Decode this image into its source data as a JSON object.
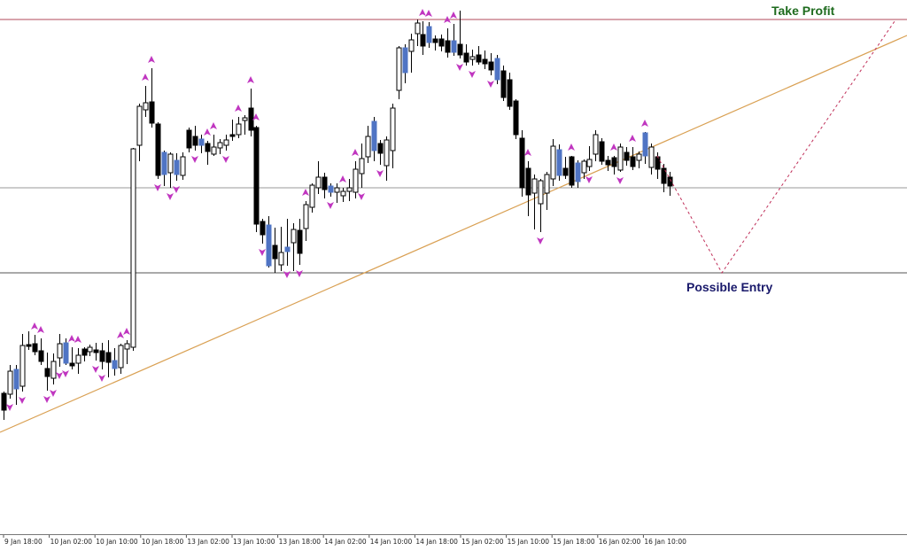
{
  "chart_data": {
    "type": "candlestick",
    "title": "",
    "xlabel": "",
    "ylabel": "",
    "grid": false,
    "ylim": [
      0,
      622
    ],
    "x_tick_labels": [
      "9 Jan 18:00",
      "10 Jan 02:00",
      "10 Jan 10:00",
      "10 Jan 18:00",
      "13 Jan 02:00",
      "13 Jan 10:00",
      "13 Jan 18:00",
      "14 Jan 02:00",
      "14 Jan 10:00",
      "14 Jan 18:00",
      "15 Jan 02:00",
      "15 Jan 10:00",
      "15 Jan 18:00",
      "16 Jan 02:00",
      "16 Jan 10:00"
    ],
    "levels": {
      "take_profit": {
        "label": "Take Profit",
        "value": 600,
        "color": "#1e6b1e",
        "line_color": "#b04a5a"
      },
      "mid_line": {
        "value": 410,
        "color": "#9a9a9a"
      },
      "possible_entry": {
        "label": "Possible Entry",
        "value": 314,
        "color": "#1a1a6b",
        "line_color": "#555555"
      }
    },
    "trendline": {
      "from": [
        0,
        134
      ],
      "to": [
        1024,
        582
      ],
      "color": "#d9a052"
    },
    "projection": {
      "points": [
        [
          742,
          446
        ],
        [
          815,
          314
        ],
        [
          1010,
          598
        ]
      ],
      "color": "#c0305a"
    },
    "colors": {
      "bull": "#ffffff",
      "bear": "#000000",
      "blue": "#4f74c4",
      "fractal": "#c036c0"
    },
    "candles": [
      {
        "o": 159,
        "c": 178,
        "h": 180,
        "l": 148,
        "t": "b"
      },
      {
        "o": 203,
        "c": 177,
        "h": 210,
        "l": 172,
        "t": "u"
      },
      {
        "o": 183,
        "c": 205,
        "h": 210,
        "l": 165,
        "t": "bl"
      },
      {
        "o": 186,
        "c": 232,
        "h": 245,
        "l": 180,
        "t": "u"
      },
      {
        "o": 231,
        "c": 233,
        "h": 248,
        "l": 227,
        "t": "d"
      },
      {
        "o": 225,
        "c": 234,
        "h": 244,
        "l": 221,
        "t": "d"
      },
      {
        "o": 226,
        "c": 214,
        "h": 240,
        "l": 210,
        "t": "b"
      },
      {
        "o": 206,
        "c": 197,
        "h": 224,
        "l": 181,
        "t": "b"
      },
      {
        "o": 214,
        "c": 195,
        "h": 223,
        "l": 188,
        "t": "u"
      },
      {
        "o": 218,
        "c": 234,
        "h": 245,
        "l": 208,
        "t": "u"
      },
      {
        "o": 235,
        "c": 212,
        "h": 240,
        "l": 210,
        "t": "bl"
      },
      {
        "o": 212,
        "c": 209,
        "h": 230,
        "l": 205,
        "t": "d"
      },
      {
        "o": 212,
        "c": 221,
        "h": 229,
        "l": 200,
        "t": "u"
      },
      {
        "o": 228,
        "c": 221,
        "h": 230,
        "l": 214,
        "t": "b"
      },
      {
        "o": 225,
        "c": 230,
        "h": 233,
        "l": 220,
        "t": "u"
      },
      {
        "o": 227,
        "c": 224,
        "h": 235,
        "l": 215,
        "t": "d"
      },
      {
        "o": 226,
        "c": 214,
        "h": 235,
        "l": 205,
        "t": "b"
      },
      {
        "o": 224,
        "c": 213,
        "h": 238,
        "l": 196,
        "t": "d"
      },
      {
        "o": 215,
        "c": 206,
        "h": 229,
        "l": 198,
        "t": "bl"
      },
      {
        "o": 207,
        "c": 232,
        "h": 234,
        "l": 200,
        "t": "u"
      },
      {
        "o": 228,
        "c": 234,
        "h": 238,
        "l": 211,
        "t": "u"
      },
      {
        "o": 230,
        "c": 454,
        "h": 455,
        "l": 226,
        "t": "u"
      },
      {
        "o": 458,
        "c": 502,
        "h": 505,
        "l": 440,
        "t": "u"
      },
      {
        "o": 498,
        "c": 506,
        "h": 525,
        "l": 490,
        "t": "u"
      },
      {
        "o": 507,
        "c": 483,
        "h": 545,
        "l": 478,
        "t": "b"
      },
      {
        "o": 482,
        "c": 424,
        "h": 484,
        "l": 420,
        "t": "b"
      },
      {
        "o": 450,
        "c": 425,
        "h": 452,
        "l": 412,
        "t": "bl"
      },
      {
        "o": 427,
        "c": 448,
        "h": 450,
        "l": 410,
        "t": "u"
      },
      {
        "o": 441,
        "c": 425,
        "h": 449,
        "l": 418,
        "t": "bl"
      },
      {
        "o": 424,
        "c": 445,
        "h": 450,
        "l": 419,
        "t": "u"
      },
      {
        "o": 475,
        "c": 455,
        "h": 478,
        "l": 450,
        "t": "b"
      },
      {
        "o": 468,
        "c": 458,
        "h": 480,
        "l": 452,
        "t": "b"
      },
      {
        "o": 465,
        "c": 458,
        "h": 470,
        "l": 449,
        "t": "bl"
      },
      {
        "o": 460,
        "c": 451,
        "h": 463,
        "l": 436,
        "t": "b"
      },
      {
        "o": 448,
        "c": 456,
        "h": 470,
        "l": 446,
        "t": "u"
      },
      {
        "o": 455,
        "c": 461,
        "h": 465,
        "l": 448,
        "t": "u"
      },
      {
        "o": 458,
        "c": 464,
        "h": 470,
        "l": 452,
        "t": "u"
      },
      {
        "o": 468,
        "c": 470,
        "h": 487,
        "l": 463,
        "t": "d"
      },
      {
        "o": 470,
        "c": 482,
        "h": 490,
        "l": 466,
        "t": "u"
      },
      {
        "o": 486,
        "c": 489,
        "h": 492,
        "l": 470,
        "t": "u"
      },
      {
        "o": 500,
        "c": 475,
        "h": 522,
        "l": 468,
        "t": "b"
      },
      {
        "o": 478,
        "c": 369,
        "h": 480,
        "l": 360,
        "t": "b"
      },
      {
        "o": 372,
        "c": 357,
        "h": 375,
        "l": 347,
        "t": "b"
      },
      {
        "o": 368,
        "c": 322,
        "h": 378,
        "l": 320,
        "t": "bl"
      },
      {
        "o": 345,
        "c": 330,
        "h": 365,
        "l": 314,
        "t": "b"
      },
      {
        "o": 323,
        "c": 337,
        "h": 366,
        "l": 316,
        "t": "u"
      },
      {
        "o": 343,
        "c": 338,
        "h": 375,
        "l": 322,
        "t": "bl"
      },
      {
        "o": 363,
        "c": 348,
        "h": 370,
        "l": 316,
        "t": "u"
      },
      {
        "o": 336,
        "c": 362,
        "h": 375,
        "l": 323,
        "t": "b"
      },
      {
        "o": 364,
        "c": 391,
        "h": 395,
        "l": 350,
        "t": "u"
      },
      {
        "o": 388,
        "c": 413,
        "h": 415,
        "l": 382,
        "t": "u"
      },
      {
        "o": 410,
        "c": 422,
        "h": 440,
        "l": 403,
        "t": "u"
      },
      {
        "o": 408,
        "c": 422,
        "h": 427,
        "l": 398,
        "t": "b"
      },
      {
        "o": 412,
        "c": 405,
        "h": 415,
        "l": 400,
        "t": "bl"
      },
      {
        "o": 405,
        "c": 410,
        "h": 415,
        "l": 393,
        "t": "u"
      },
      {
        "o": 401,
        "c": 406,
        "h": 410,
        "l": 394,
        "t": "u"
      },
      {
        "o": 406,
        "c": 410,
        "h": 420,
        "l": 395,
        "t": "u"
      },
      {
        "o": 405,
        "c": 431,
        "h": 440,
        "l": 398,
        "t": "u"
      },
      {
        "o": 443,
        "c": 426,
        "h": 460,
        "l": 410,
        "t": "u"
      },
      {
        "o": 468,
        "c": 445,
        "h": 480,
        "l": 438,
        "t": "u"
      },
      {
        "o": 452,
        "c": 485,
        "h": 490,
        "l": 440,
        "t": "bl"
      },
      {
        "o": 460,
        "c": 449,
        "h": 464,
        "l": 436,
        "t": "b"
      },
      {
        "o": 435,
        "c": 464,
        "h": 468,
        "l": 418,
        "t": "u"
      },
      {
        "o": 452,
        "c": 500,
        "h": 505,
        "l": 432,
        "t": "u"
      },
      {
        "o": 520,
        "c": 568,
        "h": 570,
        "l": 510,
        "t": "u"
      },
      {
        "o": 540,
        "c": 568,
        "h": 572,
        "l": 528,
        "t": "bl"
      },
      {
        "o": 564,
        "c": 577,
        "h": 584,
        "l": 540,
        "t": "u"
      },
      {
        "o": 596,
        "c": 584,
        "h": 600,
        "l": 570,
        "t": "u"
      },
      {
        "o": 583,
        "c": 570,
        "h": 598,
        "l": 560,
        "t": "b"
      },
      {
        "o": 592,
        "c": 574,
        "h": 597,
        "l": 568,
        "t": "bl"
      },
      {
        "o": 578,
        "c": 574,
        "h": 582,
        "l": 565,
        "t": "d"
      },
      {
        "o": 578,
        "c": 570,
        "h": 583,
        "l": 564,
        "t": "b"
      },
      {
        "o": 576,
        "c": 563,
        "h": 590,
        "l": 557,
        "t": "b"
      },
      {
        "o": 563,
        "c": 576,
        "h": 595,
        "l": 559,
        "t": "bl"
      },
      {
        "o": 572,
        "c": 560,
        "h": 610,
        "l": 556,
        "t": "b"
      },
      {
        "o": 562,
        "c": 552,
        "h": 572,
        "l": 548,
        "t": "b"
      },
      {
        "o": 555,
        "c": 558,
        "h": 566,
        "l": 548,
        "t": "u"
      },
      {
        "o": 560,
        "c": 552,
        "h": 570,
        "l": 549,
        "t": "b"
      },
      {
        "o": 555,
        "c": 550,
        "h": 565,
        "l": 544,
        "t": "d"
      },
      {
        "o": 552,
        "c": 543,
        "h": 562,
        "l": 537,
        "t": "b"
      },
      {
        "o": 556,
        "c": 532,
        "h": 560,
        "l": 527,
        "t": "bl"
      },
      {
        "o": 542,
        "c": 512,
        "h": 548,
        "l": 508,
        "t": "b"
      },
      {
        "o": 532,
        "c": 502,
        "h": 540,
        "l": 498,
        "t": "b"
      },
      {
        "o": 508,
        "c": 470,
        "h": 510,
        "l": 465,
        "t": "b"
      },
      {
        "o": 466,
        "c": 410,
        "h": 475,
        "l": 400,
        "t": "b"
      },
      {
        "o": 432,
        "c": 402,
        "h": 440,
        "l": 378,
        "t": "b"
      },
      {
        "o": 404,
        "c": 420,
        "h": 425,
        "l": 363,
        "t": "u"
      },
      {
        "o": 392,
        "c": 418,
        "h": 420,
        "l": 360,
        "t": "u"
      },
      {
        "o": 404,
        "c": 425,
        "h": 428,
        "l": 385,
        "t": "u"
      },
      {
        "o": 420,
        "c": 457,
        "h": 465,
        "l": 412,
        "t": "u"
      },
      {
        "o": 453,
        "c": 424,
        "h": 459,
        "l": 418,
        "t": "bl"
      },
      {
        "o": 424,
        "c": 432,
        "h": 445,
        "l": 420,
        "t": "d"
      },
      {
        "o": 445,
        "c": 413,
        "h": 446,
        "l": 410,
        "t": "b"
      },
      {
        "o": 417,
        "c": 438,
        "h": 441,
        "l": 410,
        "t": "bl"
      },
      {
        "o": 427,
        "c": 440,
        "h": 442,
        "l": 420,
        "t": "u"
      },
      {
        "o": 434,
        "c": 442,
        "h": 457,
        "l": 429,
        "t": "u"
      },
      {
        "o": 470,
        "c": 448,
        "h": 475,
        "l": 440,
        "t": "u"
      },
      {
        "o": 462,
        "c": 440,
        "h": 466,
        "l": 436,
        "t": "b"
      },
      {
        "o": 436,
        "c": 441,
        "h": 446,
        "l": 429,
        "t": "d"
      },
      {
        "o": 444,
        "c": 434,
        "h": 446,
        "l": 425,
        "t": "b"
      },
      {
        "o": 430,
        "c": 456,
        "h": 460,
        "l": 428,
        "t": "u"
      },
      {
        "o": 450,
        "c": 441,
        "h": 456,
        "l": 435,
        "t": "b"
      },
      {
        "o": 445,
        "c": 434,
        "h": 456,
        "l": 430,
        "t": "b"
      },
      {
        "o": 441,
        "c": 448,
        "h": 451,
        "l": 432,
        "t": "u"
      },
      {
        "o": 446,
        "c": 472,
        "h": 473,
        "l": 437,
        "t": "bl"
      },
      {
        "o": 433,
        "c": 456,
        "h": 460,
        "l": 425,
        "t": "u"
      },
      {
        "o": 445,
        "c": 431,
        "h": 450,
        "l": 420,
        "t": "b"
      },
      {
        "o": 432,
        "c": 415,
        "h": 437,
        "l": 405,
        "t": "b"
      },
      {
        "o": 422,
        "c": 412,
        "h": 428,
        "l": 401,
        "t": "b"
      }
    ],
    "fractals_up": [
      5,
      6,
      11,
      12,
      19,
      20,
      23,
      24,
      33,
      34,
      38,
      40,
      41,
      49,
      55,
      57,
      68,
      69,
      72,
      73,
      85,
      92,
      99,
      102,
      104
    ],
    "fractals_down": [
      1,
      3,
      7,
      8,
      9,
      10,
      15,
      16,
      25,
      27,
      28,
      31,
      36,
      42,
      46,
      48,
      53,
      58,
      61,
      74,
      76,
      79,
      87,
      95,
      100
    ]
  }
}
